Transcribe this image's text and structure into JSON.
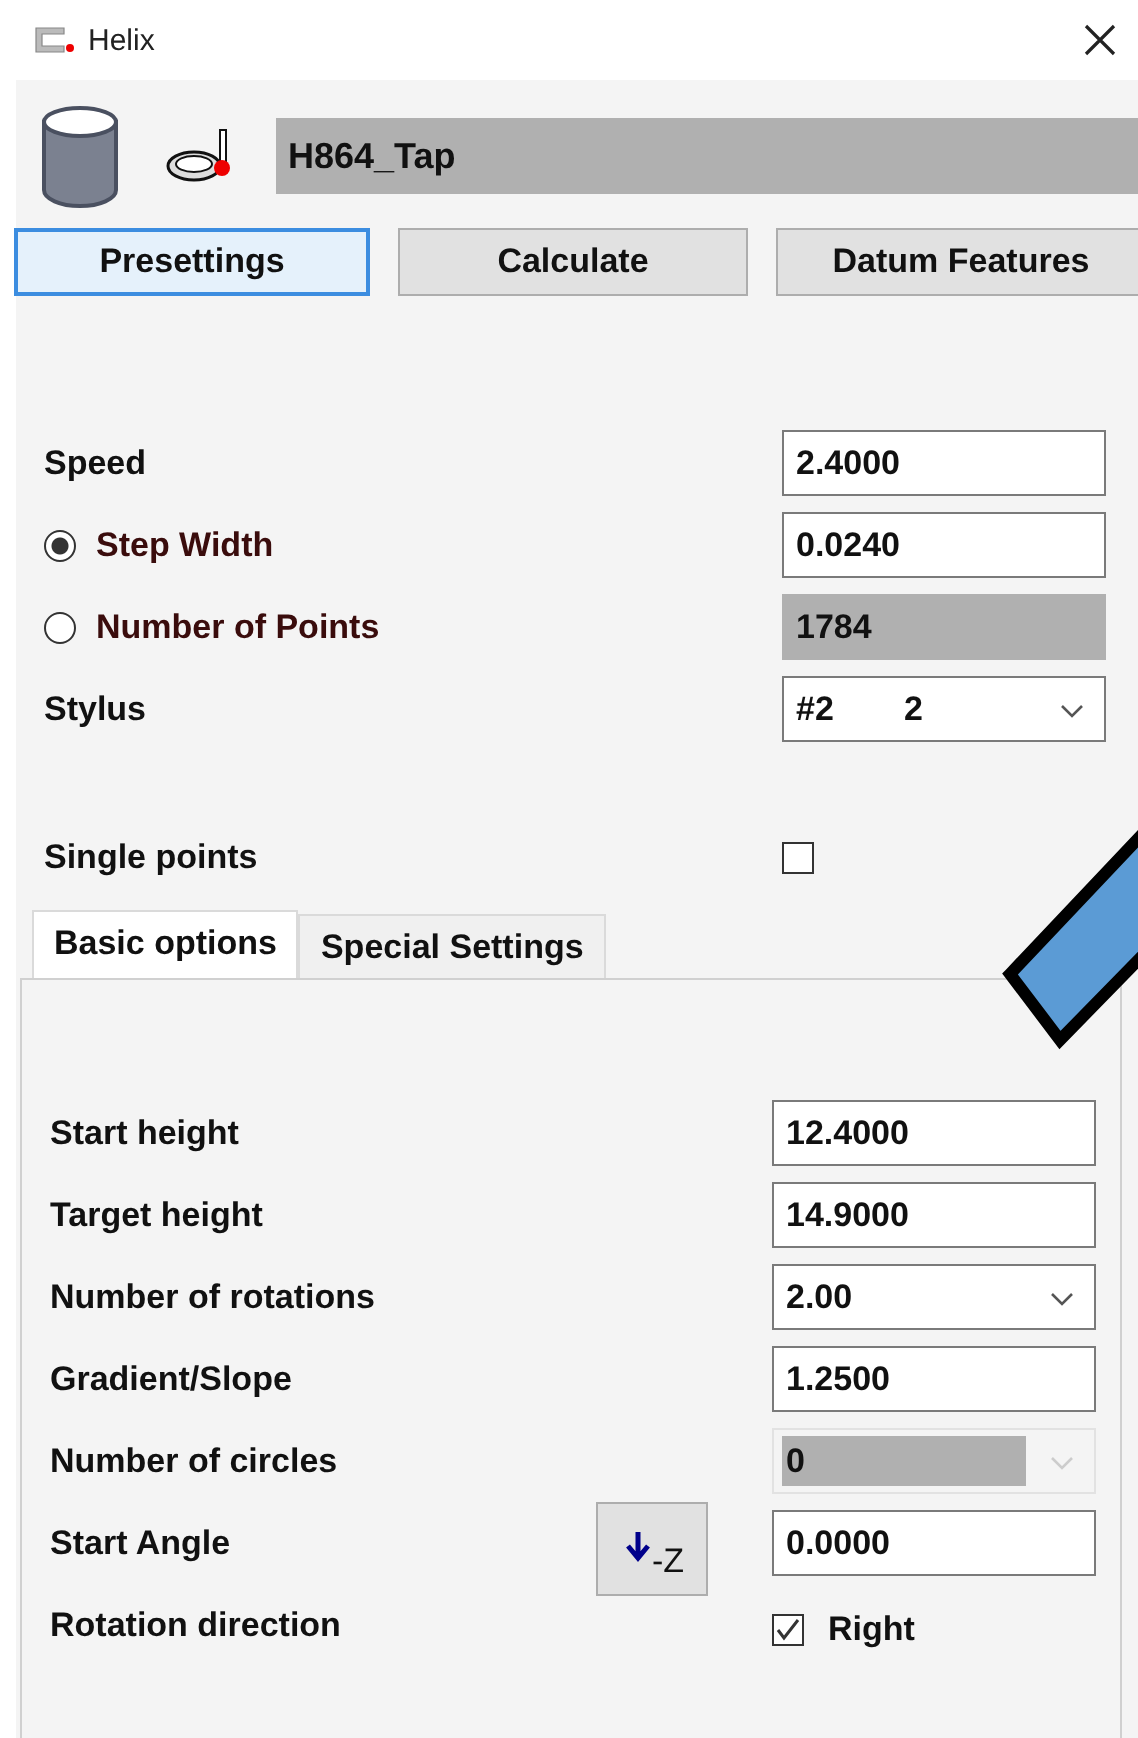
{
  "window": {
    "title": "Helix"
  },
  "part_name": "H864_Tap",
  "buttons": [
    {
      "label": "Presettings",
      "selected": true
    },
    {
      "label": "Calculate",
      "selected": false
    },
    {
      "label": "Datum Features",
      "selected": false
    }
  ],
  "settings": [
    {
      "kind": "field",
      "label": "Speed",
      "value": "2.4000"
    },
    {
      "kind": "radio",
      "label": "Step Width",
      "selected": true,
      "value": "0.0240",
      "disabled": false
    },
    {
      "kind": "radio",
      "label": "Number of Points",
      "selected": false,
      "value": "1784",
      "disabled": true
    },
    {
      "kind": "dropdown",
      "label": "Stylus",
      "value": "#2",
      "number": "2",
      "disabled": false
    }
  ],
  "single_points": {
    "label": "Single points",
    "checked": false
  },
  "tabs": [
    {
      "label": "Basic options",
      "selected": true
    },
    {
      "label": "Special Settings",
      "selected": false
    }
  ],
  "options": [
    {
      "kind": "field",
      "label": "Start height",
      "value": "12.4000"
    },
    {
      "kind": "field",
      "label": "Target height",
      "value": "14.9000"
    },
    {
      "kind": "dropdown",
      "label": "Number of rotations",
      "value": "2.00",
      "disabled": false
    },
    {
      "kind": "field",
      "label": "Gradient/Slope",
      "value": "1.2500"
    },
    {
      "kind": "dropdown",
      "label": "Number of circles",
      "value": "0",
      "disabled": true
    },
    {
      "kind": "field_button",
      "label": "Start Angle",
      "button": "-Z",
      "value": "0.0000"
    },
    {
      "kind": "checkbox",
      "label": "Rotation direction",
      "checked": true,
      "text": "Right"
    }
  ]
}
